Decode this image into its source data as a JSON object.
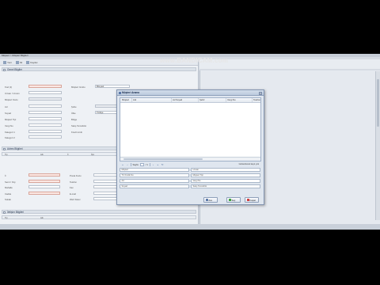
{
  "watermark": "www.BANDICAM.com",
  "app": {
    "path": "Müşteri > Müşteri Bilgileri",
    "toolbar": [
      "Yeni",
      "Sil",
      "Kaydet"
    ]
  },
  "sections": {
    "general": "Genel Bilgiler",
    "address": "Adres Bilgileri",
    "contact": "İletişim Bilgileri"
  },
  "form": {
    "labels_left": [
      "Kod (1)",
      "Unvan / Unvan",
      "Müşteri Kodu",
      "Ad",
      "Soyad",
      "Müşteri Tipi",
      "Vergi No",
      "Kategori 1",
      "Kategori 2"
    ],
    "labels_right": [
      "Müşteri Grubu",
      "Şube",
      "Ülke",
      "Bölge",
      "Satış Temsilcisi",
      "Kredi Limiti"
    ],
    "group_value": "Bireysel",
    "country_value": "Türkiye"
  },
  "address_grid": {
    "columns": [
      "Tip",
      "Adı",
      "İl",
      "İlçe"
    ],
    "labels_left": [
      "İl",
      "Semt / Köy",
      "Mahalle",
      "Cadde",
      "Sokak"
    ],
    "labels_right": [
      "Posta Kodu",
      "Telefon",
      "Fax",
      "E-mail",
      "Web Sitesi"
    ]
  },
  "contact_grid": {
    "columns": [
      "Tip",
      "Adı"
    ]
  },
  "dialog": {
    "title": "Müşteri Arama",
    "close": "×",
    "columns": [
      "Müşteri",
      "Adı",
      "Ad Soyad",
      "Şehir",
      "Vergi No",
      "Telefon"
    ],
    "pager": {
      "page_label": "Sayfa",
      "of_label": "/ 1",
      "info": "Gösterilecek kayıt yok"
    },
    "filters": [
      "Müşteri",
      "Unvan",
      "TC Kimlik No",
      "Müşteri Tipi",
      "Ad",
      "Vergi No",
      "Soyad",
      "Satış Temsilcisi"
    ],
    "buttons": {
      "search": "Ara",
      "select": "Seç",
      "close": "Kapat"
    }
  },
  "colors": {
    "required_field": "#fbe8e4",
    "accent": "#5a78a8",
    "select_button": "#3aa33a",
    "close_button": "#d23a3a"
  }
}
